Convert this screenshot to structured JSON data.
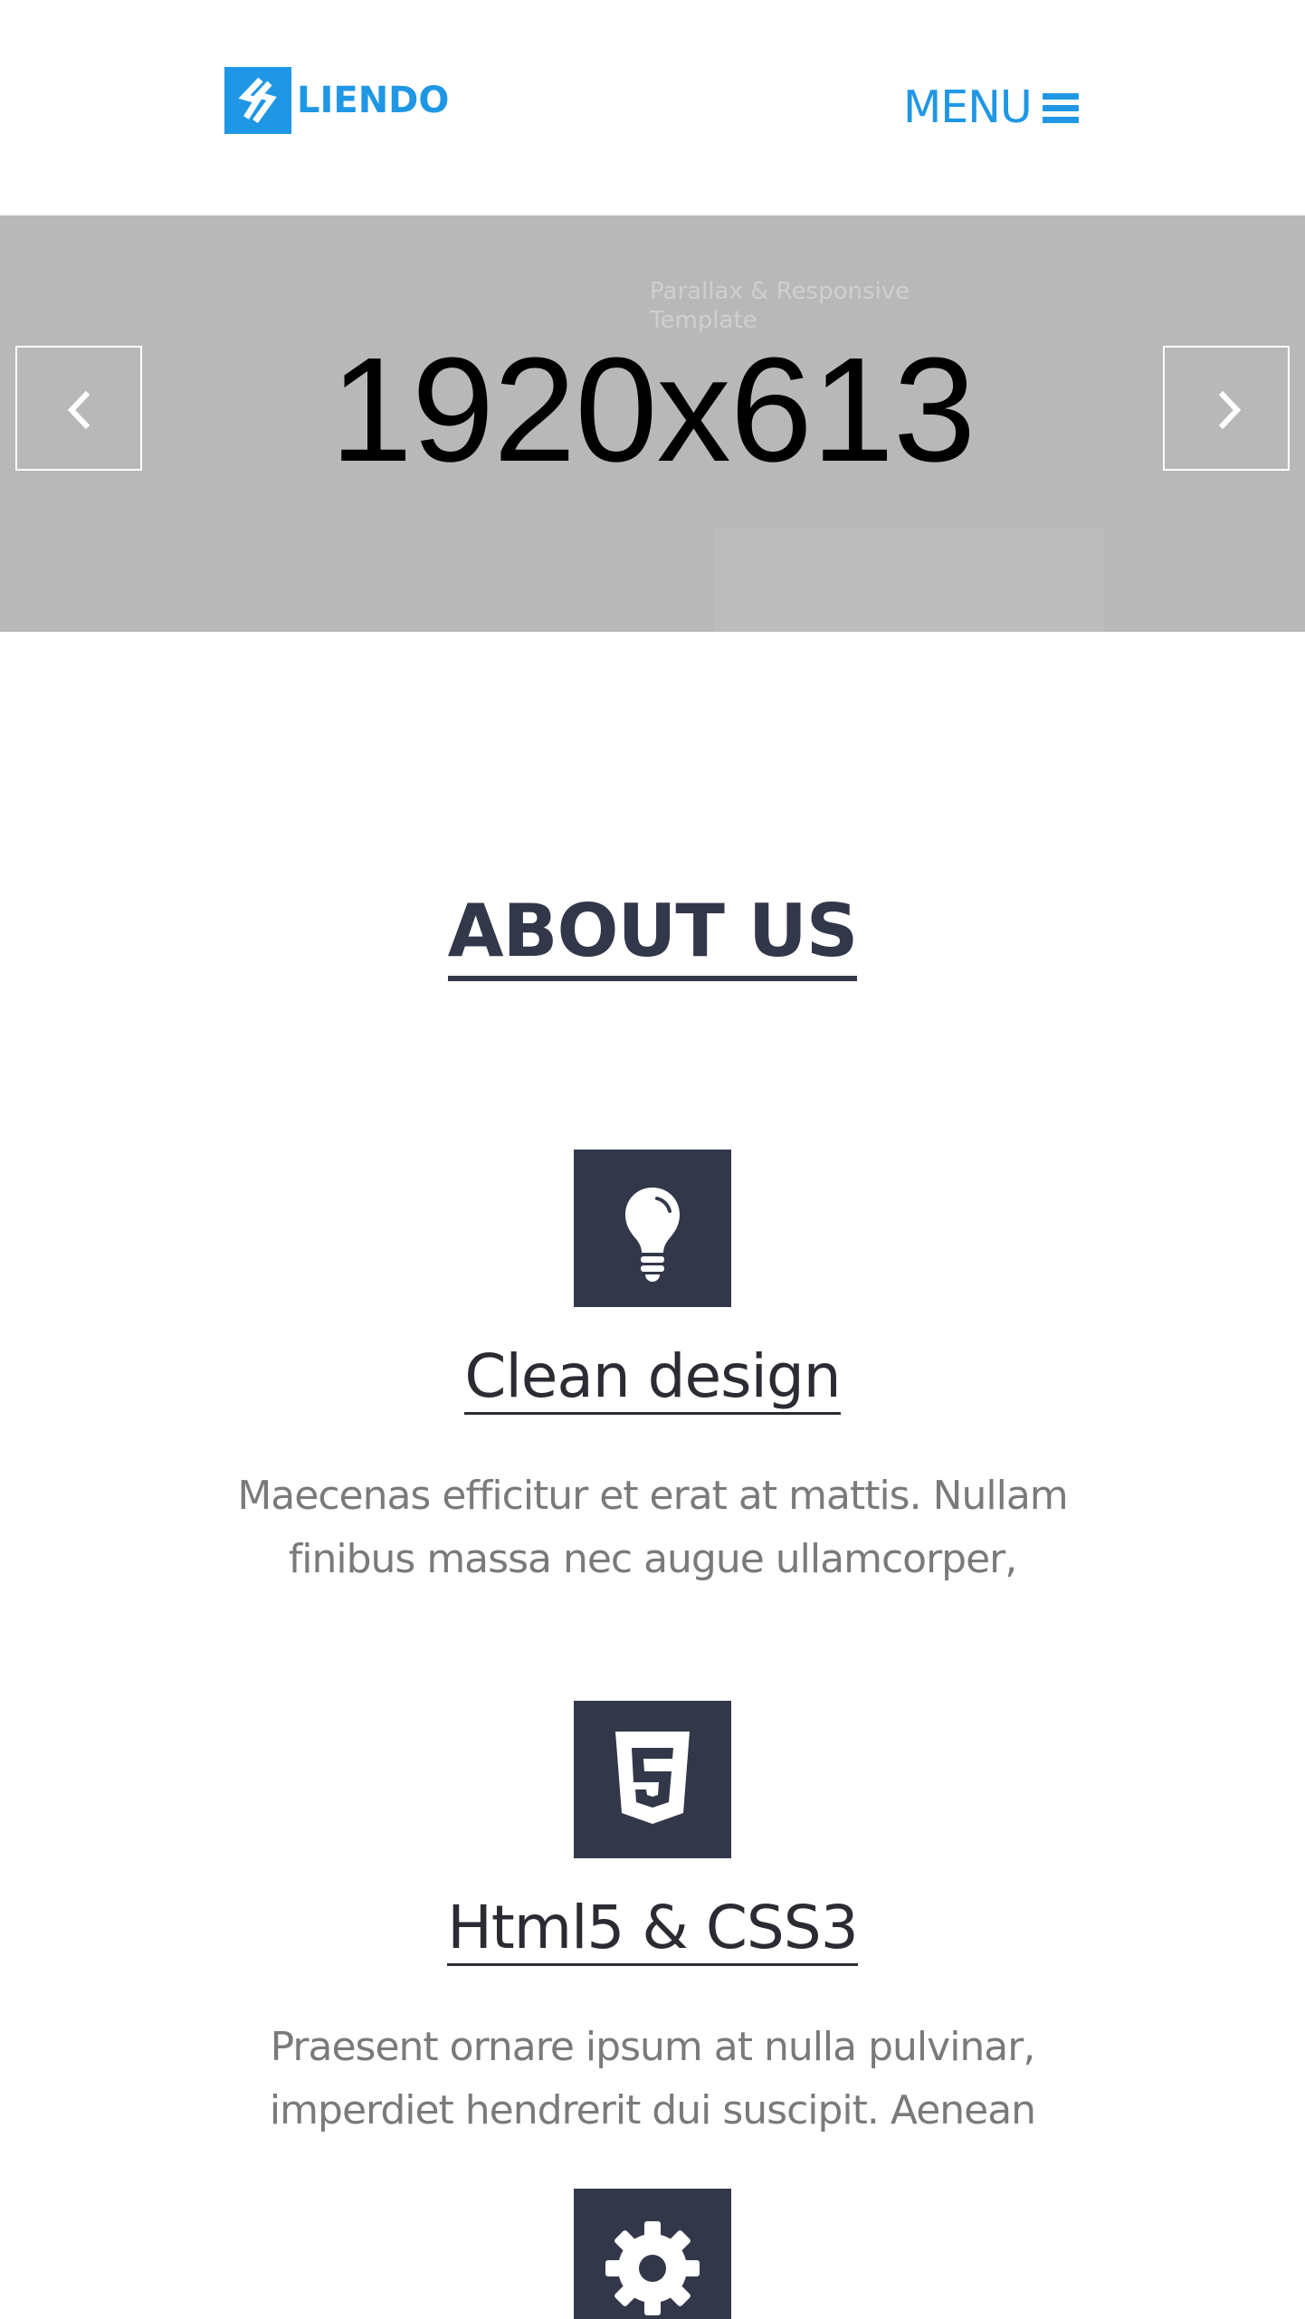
{
  "header": {
    "logo_text": "LIENDO",
    "menu_label": "MENU",
    "menu_icon": "hamburger-icon"
  },
  "hero": {
    "subtitle": "Parallax & Responsive Template",
    "placeholder_text": "1920x613",
    "prev_icon": "chevron-left-icon",
    "next_icon": "chevron-right-icon"
  },
  "about": {
    "title": "ABOUT US",
    "features": [
      {
        "icon": "lightbulb-icon",
        "title": "Clean design",
        "text": "Maecenas efficitur et erat at mattis. Nullam finibus massa nec augue ullamcorper,"
      },
      {
        "icon": "html5-icon",
        "title": "Html5 & CSS3",
        "text": "Praesent ornare ipsum at nulla pulvinar, imperdiet hendrerit dui suscipit. Aenean"
      },
      {
        "icon": "gear-icon",
        "title": "",
        "text": ""
      }
    ]
  },
  "colors": {
    "brand_blue": "#1f97e4",
    "dark_navy": "#323849",
    "hero_gray": "#b8b8b8",
    "body_text_gray": "#7a7a7a"
  }
}
